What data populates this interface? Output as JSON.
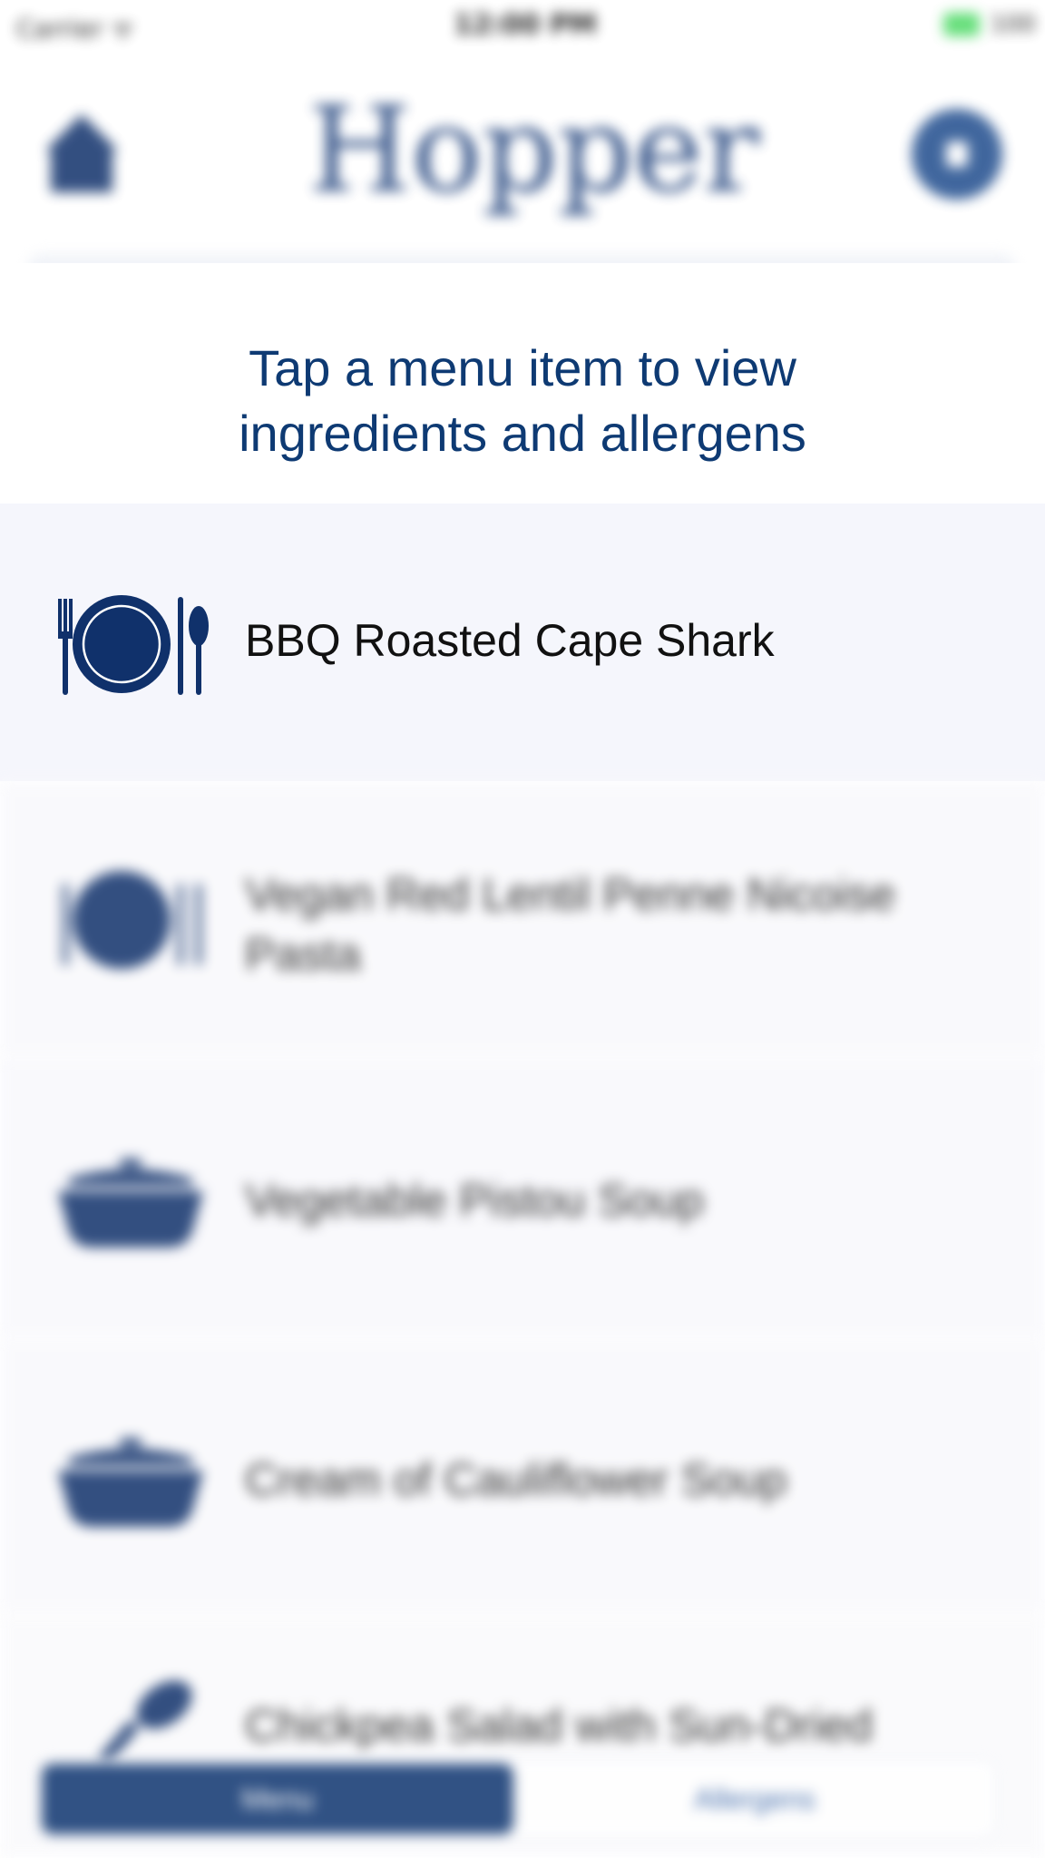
{
  "status_bar": {
    "carrier": "Carrier ᯤ",
    "time": "12:00 PM",
    "battery": "100"
  },
  "header": {
    "logo_text": "Hopper",
    "home_icon": "home-icon",
    "profile_icon": "profile-icon"
  },
  "instruction": {
    "line1": "Tap a menu item to view",
    "line2": "ingredients and allergens"
  },
  "menu": {
    "items": [
      {
        "label": "BBQ Roasted Cape Shark",
        "icon": "plate-cutlery-icon"
      },
      {
        "label": "Vegan Red Lentil Penne Nicoise Pasta",
        "icon": "plate-cutlery-icon"
      },
      {
        "label": "Vegetable Pistou Soup",
        "icon": "soup-pot-icon"
      },
      {
        "label": "Cream of Cauliflower Soup",
        "icon": "soup-pot-icon"
      },
      {
        "label": "Chickpea Salad with Sun-Dried",
        "icon": "drumstick-icon"
      }
    ]
  },
  "bottom_tabs": {
    "left": "Menu",
    "right": "Allergens"
  },
  "colors": {
    "brand_navy": "#10316b",
    "instruction_text": "#0e3a73",
    "battery_green": "#4cd964"
  }
}
